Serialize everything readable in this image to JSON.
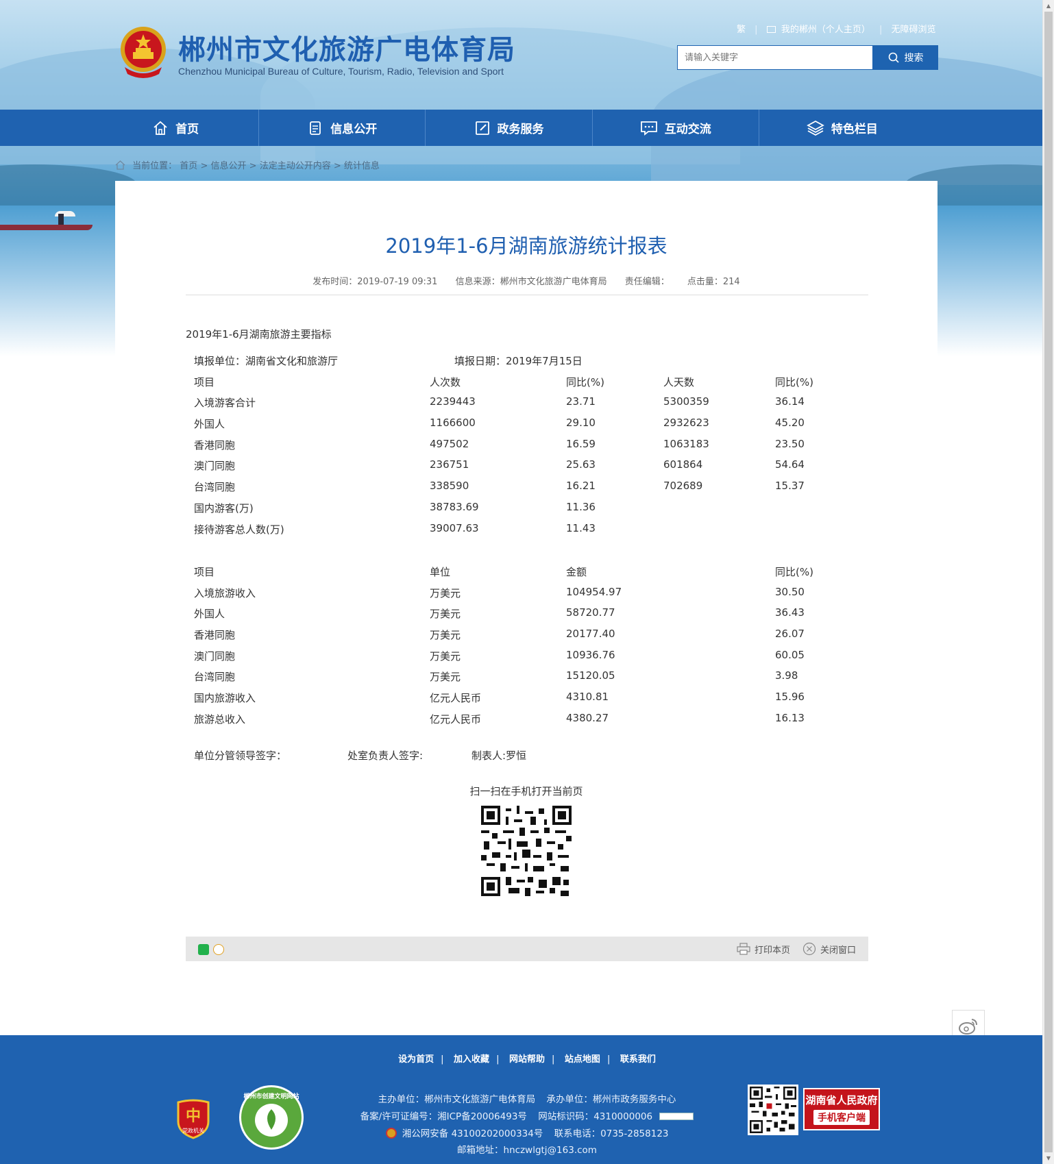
{
  "header": {
    "title_cn": "郴州市文化旅游广电体育局",
    "title_en": "Chenzhou Municipal Bureau of Culture, Tourism, Radio, Television and Sport",
    "top_links": {
      "traditional": "繁",
      "my_chenzhou": "我的郴州（个人主页）",
      "accessible": "无障碍浏览"
    },
    "search": {
      "placeholder": "请输入关键字",
      "button": "搜索"
    }
  },
  "nav": {
    "items": [
      {
        "label": "首页",
        "icon": "home-icon"
      },
      {
        "label": "信息公开",
        "icon": "document-icon"
      },
      {
        "label": "政务服务",
        "icon": "edit-icon"
      },
      {
        "label": "互动交流",
        "icon": "chat-icon"
      },
      {
        "label": "特色栏目",
        "icon": "layers-icon"
      }
    ]
  },
  "breadcrumb": {
    "label": "当前位置：",
    "items": [
      "首页",
      "信息公开",
      "法定主动公开内容",
      "统计信息"
    ],
    "sep": ">"
  },
  "article": {
    "title": "2019年1-6月湖南旅游统计报表",
    "meta": {
      "published": "发布时间：2019-07-19 09:31",
      "source": "信息来源：郴州市文化旅游广电体育局",
      "editor": "责任编辑：",
      "views": "点击量：214"
    },
    "intro": "2019年1-6月湖南旅游主要指标",
    "fill_unit": "填报单位：湖南省文化和旅游厅",
    "fill_date": "填报日期：2019年7月15日",
    "table1": {
      "headers": [
        "项目",
        "人次数",
        "同比(%)",
        "人天数",
        "同比(%)"
      ],
      "rows": [
        [
          "入境游客合计",
          "2239443",
          "23.71",
          "5300359",
          "36.14"
        ],
        [
          "外国人",
          "1166600",
          "29.10",
          "2932623",
          "45.20"
        ],
        [
          "香港同胞",
          "497502",
          "16.59",
          "1063183",
          "23.50"
        ],
        [
          "澳门同胞",
          "236751",
          "25.63",
          "601864",
          "54.64"
        ],
        [
          "台湾同胞",
          "338590",
          "16.21",
          "702689",
          "15.37"
        ],
        [
          "国内游客(万)",
          "38783.69",
          "11.36",
          "",
          ""
        ],
        [
          "接待游客总人数(万)",
          "39007.63",
          "11.43",
          "",
          ""
        ]
      ]
    },
    "table2": {
      "headers": [
        "项目",
        "单位",
        "金额",
        "同比(%)"
      ],
      "rows": [
        [
          "入境旅游收入",
          "万美元",
          "104954.97",
          "30.50"
        ],
        [
          "外国人",
          "万美元",
          "58720.77",
          "36.43"
        ],
        [
          "香港同胞",
          "万美元",
          "20177.40",
          "26.07"
        ],
        [
          "澳门同胞",
          "万美元",
          "10936.76",
          "60.05"
        ],
        [
          "台湾同胞",
          "万美元",
          "15120.05",
          "3.98"
        ],
        [
          "国内旅游收入",
          "亿元人民币",
          "4310.81",
          "15.96"
        ],
        [
          "旅游总收入",
          "亿元人民币",
          "4380.27",
          "16.13"
        ]
      ]
    },
    "signatures": {
      "leader": "单位分管领导签字：",
      "office": "处室负责人签字:",
      "maker": "制表人:罗恒"
    },
    "qr_caption": "扫一扫在手机打开当前页",
    "actions": {
      "print": "打印本页",
      "close": "关闭窗口"
    }
  },
  "footer": {
    "links": [
      "设为首页",
      "加入收藏",
      "网站帮助",
      "站点地图",
      "联系我们"
    ],
    "sponsor": "主办单位：郴州市文化旅游广电体育局",
    "organizer": "承办单位：郴州市政务服务中心",
    "icp": "备案/许可证编号：湘ICP备20006493号",
    "site_code": "网站标识码：4310000006",
    "police": "湘公网安备 43100202000334号",
    "phone": "联系电话：0735-2858123",
    "email": "邮箱地址：hnczwlgtj@163.com",
    "party_badge": "党政机关",
    "civil_badge": "郴州市创建文明网站",
    "gov_app_line1": "湖南省人民政府",
    "gov_app_line2": "手机客户端"
  },
  "colors": {
    "brand_blue": "#1f62b0",
    "title_blue": "#1f5fb0",
    "gov_red": "#c4141b"
  }
}
